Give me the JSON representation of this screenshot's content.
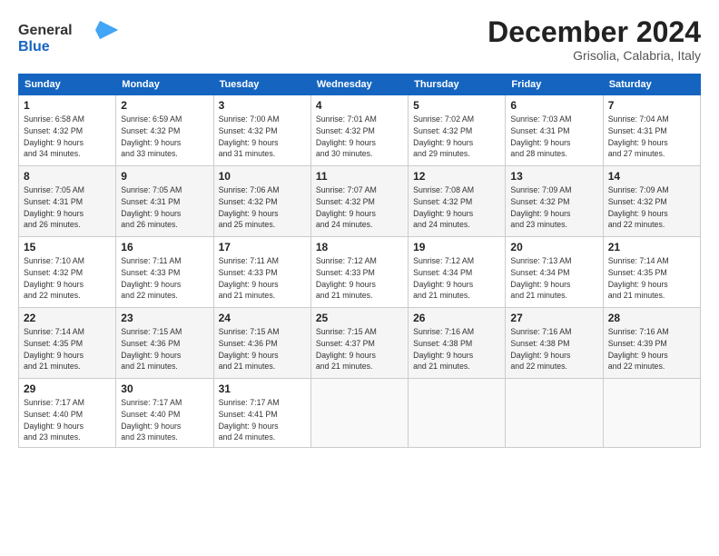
{
  "header": {
    "logo_line1": "General",
    "logo_line2": "Blue",
    "month": "December 2024",
    "location": "Grisolia, Calabria, Italy"
  },
  "weekdays": [
    "Sunday",
    "Monday",
    "Tuesday",
    "Wednesday",
    "Thursday",
    "Friday",
    "Saturday"
  ],
  "weeks": [
    [
      {
        "day": "1",
        "info": "Sunrise: 6:58 AM\nSunset: 4:32 PM\nDaylight: 9 hours\nand 34 minutes."
      },
      {
        "day": "2",
        "info": "Sunrise: 6:59 AM\nSunset: 4:32 PM\nDaylight: 9 hours\nand 33 minutes."
      },
      {
        "day": "3",
        "info": "Sunrise: 7:00 AM\nSunset: 4:32 PM\nDaylight: 9 hours\nand 31 minutes."
      },
      {
        "day": "4",
        "info": "Sunrise: 7:01 AM\nSunset: 4:32 PM\nDaylight: 9 hours\nand 30 minutes."
      },
      {
        "day": "5",
        "info": "Sunrise: 7:02 AM\nSunset: 4:32 PM\nDaylight: 9 hours\nand 29 minutes."
      },
      {
        "day": "6",
        "info": "Sunrise: 7:03 AM\nSunset: 4:31 PM\nDaylight: 9 hours\nand 28 minutes."
      },
      {
        "day": "7",
        "info": "Sunrise: 7:04 AM\nSunset: 4:31 PM\nDaylight: 9 hours\nand 27 minutes."
      }
    ],
    [
      {
        "day": "8",
        "info": "Sunrise: 7:05 AM\nSunset: 4:31 PM\nDaylight: 9 hours\nand 26 minutes."
      },
      {
        "day": "9",
        "info": "Sunrise: 7:05 AM\nSunset: 4:31 PM\nDaylight: 9 hours\nand 26 minutes."
      },
      {
        "day": "10",
        "info": "Sunrise: 7:06 AM\nSunset: 4:32 PM\nDaylight: 9 hours\nand 25 minutes."
      },
      {
        "day": "11",
        "info": "Sunrise: 7:07 AM\nSunset: 4:32 PM\nDaylight: 9 hours\nand 24 minutes."
      },
      {
        "day": "12",
        "info": "Sunrise: 7:08 AM\nSunset: 4:32 PM\nDaylight: 9 hours\nand 24 minutes."
      },
      {
        "day": "13",
        "info": "Sunrise: 7:09 AM\nSunset: 4:32 PM\nDaylight: 9 hours\nand 23 minutes."
      },
      {
        "day": "14",
        "info": "Sunrise: 7:09 AM\nSunset: 4:32 PM\nDaylight: 9 hours\nand 22 minutes."
      }
    ],
    [
      {
        "day": "15",
        "info": "Sunrise: 7:10 AM\nSunset: 4:32 PM\nDaylight: 9 hours\nand 22 minutes."
      },
      {
        "day": "16",
        "info": "Sunrise: 7:11 AM\nSunset: 4:33 PM\nDaylight: 9 hours\nand 22 minutes."
      },
      {
        "day": "17",
        "info": "Sunrise: 7:11 AM\nSunset: 4:33 PM\nDaylight: 9 hours\nand 21 minutes."
      },
      {
        "day": "18",
        "info": "Sunrise: 7:12 AM\nSunset: 4:33 PM\nDaylight: 9 hours\nand 21 minutes."
      },
      {
        "day": "19",
        "info": "Sunrise: 7:12 AM\nSunset: 4:34 PM\nDaylight: 9 hours\nand 21 minutes."
      },
      {
        "day": "20",
        "info": "Sunrise: 7:13 AM\nSunset: 4:34 PM\nDaylight: 9 hours\nand 21 minutes."
      },
      {
        "day": "21",
        "info": "Sunrise: 7:14 AM\nSunset: 4:35 PM\nDaylight: 9 hours\nand 21 minutes."
      }
    ],
    [
      {
        "day": "22",
        "info": "Sunrise: 7:14 AM\nSunset: 4:35 PM\nDaylight: 9 hours\nand 21 minutes."
      },
      {
        "day": "23",
        "info": "Sunrise: 7:15 AM\nSunset: 4:36 PM\nDaylight: 9 hours\nand 21 minutes."
      },
      {
        "day": "24",
        "info": "Sunrise: 7:15 AM\nSunset: 4:36 PM\nDaylight: 9 hours\nand 21 minutes."
      },
      {
        "day": "25",
        "info": "Sunrise: 7:15 AM\nSunset: 4:37 PM\nDaylight: 9 hours\nand 21 minutes."
      },
      {
        "day": "26",
        "info": "Sunrise: 7:16 AM\nSunset: 4:38 PM\nDaylight: 9 hours\nand 21 minutes."
      },
      {
        "day": "27",
        "info": "Sunrise: 7:16 AM\nSunset: 4:38 PM\nDaylight: 9 hours\nand 22 minutes."
      },
      {
        "day": "28",
        "info": "Sunrise: 7:16 AM\nSunset: 4:39 PM\nDaylight: 9 hours\nand 22 minutes."
      }
    ],
    [
      {
        "day": "29",
        "info": "Sunrise: 7:17 AM\nSunset: 4:40 PM\nDaylight: 9 hours\nand 23 minutes."
      },
      {
        "day": "30",
        "info": "Sunrise: 7:17 AM\nSunset: 4:40 PM\nDaylight: 9 hours\nand 23 minutes."
      },
      {
        "day": "31",
        "info": "Sunrise: 7:17 AM\nSunset: 4:41 PM\nDaylight: 9 hours\nand 24 minutes."
      },
      {
        "day": "",
        "info": ""
      },
      {
        "day": "",
        "info": ""
      },
      {
        "day": "",
        "info": ""
      },
      {
        "day": "",
        "info": ""
      }
    ]
  ]
}
